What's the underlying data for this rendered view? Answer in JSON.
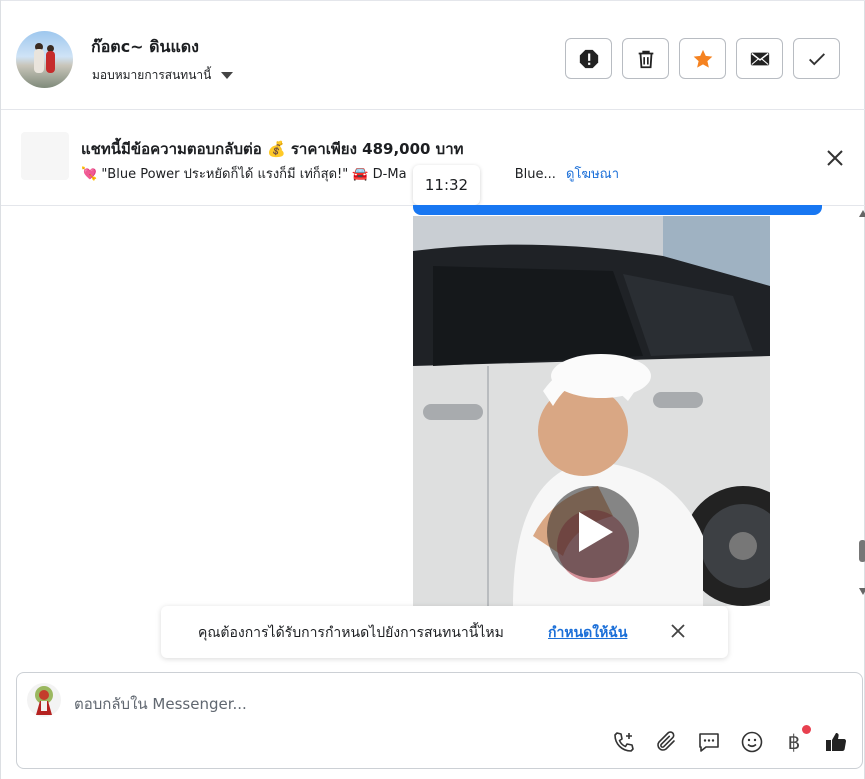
{
  "header": {
    "contact_name": "ก๊อตc~ ดินแดง",
    "assign_label": "มอบหมายการสนทนานี้",
    "actions": [
      "mark-spam",
      "delete",
      "star",
      "mark-unread",
      "mark-done"
    ]
  },
  "ad": {
    "title": "แชทนี้มีข้อความตอบกลับต่อ 💰 ราคาเพียง 489,000 บาท",
    "subtitle": "💘 \"Blue Power ประหยัดก็ได้ แรงก็มี เท่ก็สุด!\" 🚘 D-Ma",
    "subtitle_tail": "Blue...",
    "link": "ดูโฆษณา"
  },
  "chat": {
    "timestamp": "11:32",
    "video_label": "video-message"
  },
  "prompt": {
    "text": "คุณต้องการได้รับการกำหนดไปยังการสนทนานี้ไหม",
    "link": "กำหนดให้ฉัน"
  },
  "composer": {
    "placeholder": "ตอบกลับใน Messenger...",
    "currency_symbol": "฿"
  },
  "colors": {
    "accent": "#1877f2",
    "link": "#1b6fd8",
    "star": "#f58220",
    "badge": "#e8404f"
  }
}
